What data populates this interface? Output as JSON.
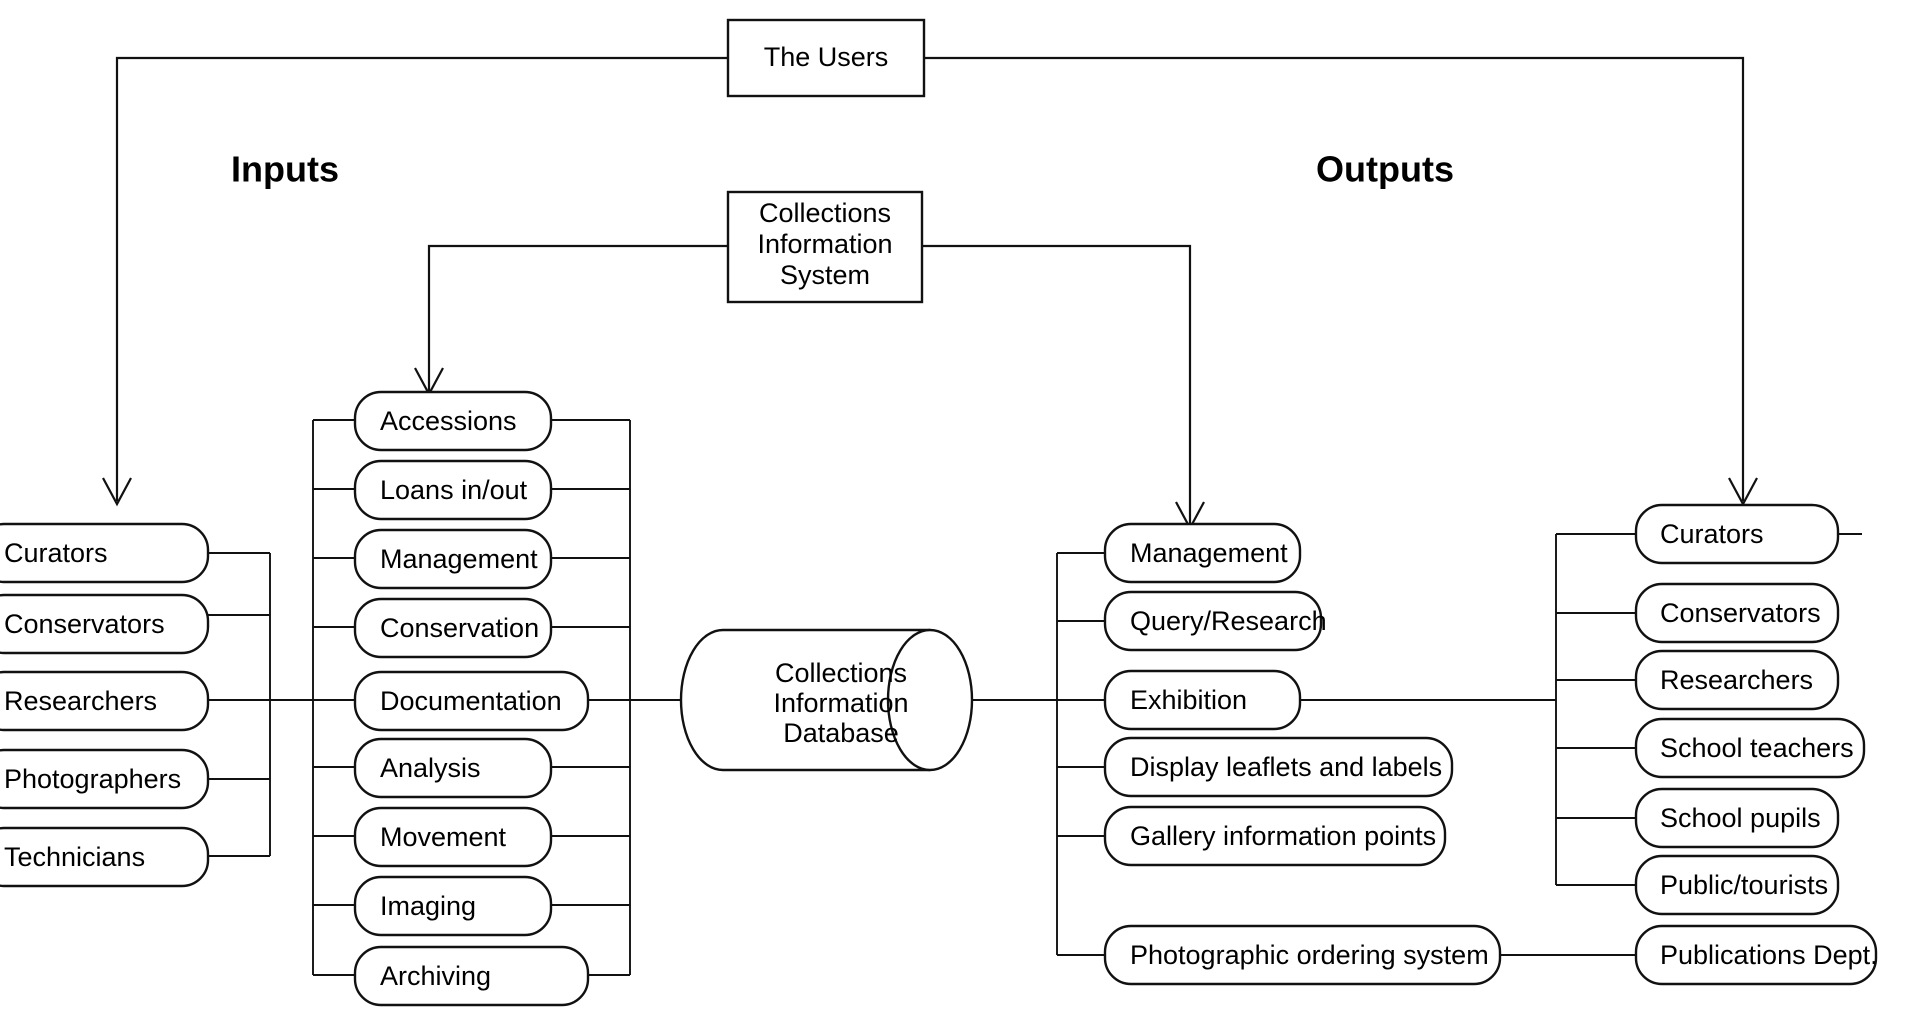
{
  "diagram": {
    "title": "The Users",
    "headings": {
      "inputs": "Inputs",
      "outputs": "Outputs"
    },
    "top_node": {
      "label": "The Users"
    },
    "system_node": {
      "line1": "Collections",
      "line2": "Information",
      "line3": "System"
    },
    "database_node": {
      "line1": "Collections",
      "line2": "Information",
      "line3": "Database"
    },
    "input_users": [
      {
        "label": "Curators"
      },
      {
        "label": "Conservators"
      },
      {
        "label": "Researchers"
      },
      {
        "label": "Photographers"
      },
      {
        "label": "Technicians"
      }
    ],
    "input_functions": [
      {
        "label": "Accessions"
      },
      {
        "label": "Loans in/out"
      },
      {
        "label": "Management"
      },
      {
        "label": "Conservation"
      },
      {
        "label": "Documentation"
      },
      {
        "label": "Analysis"
      },
      {
        "label": "Movement"
      },
      {
        "label": "Imaging"
      },
      {
        "label": "Archiving"
      }
    ],
    "output_functions": [
      {
        "label": "Management"
      },
      {
        "label": "Query/Research"
      },
      {
        "label": "Exhibition"
      },
      {
        "label": "Display leaflets and labels"
      },
      {
        "label": "Gallery information points"
      },
      {
        "label": "Photographic ordering system"
      }
    ],
    "output_users": [
      {
        "label": "Curators"
      },
      {
        "label": "Conservators"
      },
      {
        "label": "Researchers"
      },
      {
        "label": "School teachers"
      },
      {
        "label": "School pupils"
      },
      {
        "label": "Public/tourists"
      },
      {
        "label": "Publications Dept."
      }
    ],
    "colors": {
      "stroke": "#111111",
      "fill": "#ffffff",
      "text": "#000000"
    }
  }
}
